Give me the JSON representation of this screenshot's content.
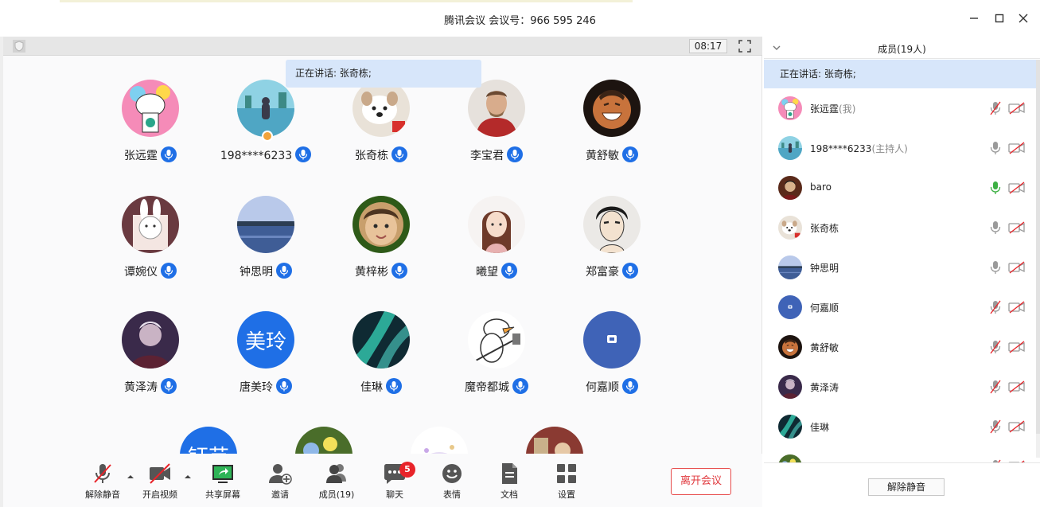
{
  "window": {
    "title": "腾讯会议 会议号：966 595 246"
  },
  "meeting": {
    "timer": "08:17",
    "speaking_tip": "正在讲话: 张奇栋;"
  },
  "tiles": [
    {
      "name": "张远霆",
      "avatar": "kid-drawing",
      "text": ""
    },
    {
      "name": "198****6233",
      "avatar": "lake-figure",
      "text": "",
      "host": true
    },
    {
      "name": "张奇栋",
      "avatar": "dog",
      "text": ""
    },
    {
      "name": "李宝君",
      "avatar": "man-red",
      "text": ""
    },
    {
      "name": "黄舒敏",
      "avatar": "laughing",
      "text": ""
    },
    {
      "name": "谭婉仪",
      "avatar": "bunny",
      "text": ""
    },
    {
      "name": "钟思明",
      "avatar": "lakeview",
      "text": ""
    },
    {
      "name": "黄梓彬",
      "avatar": "child",
      "text": ""
    },
    {
      "name": "曦望",
      "avatar": "girl",
      "text": ""
    },
    {
      "name": "郑富豪",
      "avatar": "anime-man",
      "text": ""
    },
    {
      "name": "黄泽涛",
      "avatar": "dark-figure",
      "text": ""
    },
    {
      "name": "唐美玲",
      "avatar": "text-blue",
      "text": "美玲"
    },
    {
      "name": "佳琳",
      "avatar": "aurora",
      "text": ""
    },
    {
      "name": "魔帝都城",
      "avatar": "duck",
      "text": ""
    },
    {
      "name": "何嘉顺",
      "avatar": "blue-icon",
      "text": ""
    },
    {
      "name": "",
      "avatar": "text-blue",
      "text": "钰芸"
    },
    {
      "name": "",
      "avatar": "flowers",
      "text": ""
    },
    {
      "name": "",
      "avatar": "cartoon",
      "text": ""
    },
    {
      "name": "",
      "avatar": "red-scene",
      "text": ""
    }
  ],
  "toolbar": {
    "unmute": "解除静音",
    "video": "开启视频",
    "share": "共享屏幕",
    "invite": "邀请",
    "members": "成员(19)",
    "chat": "聊天",
    "chat_badge": "5",
    "emoji": "表情",
    "docs": "文档",
    "settings": "设置",
    "leave": "离开会议"
  },
  "panel": {
    "title": "成员(19人)",
    "speaking": "正在讲话: 张奇栋;",
    "unmute_all": "解除静音",
    "members": [
      {
        "name": "张远霆",
        "role": "(我)",
        "avatar": "kid-drawing",
        "mic": "muted"
      },
      {
        "name": "198****6233",
        "role": "(主持人)",
        "avatar": "lake-figure",
        "mic": "on"
      },
      {
        "name": "baro",
        "role": "",
        "avatar": "baro",
        "mic": "speaking"
      },
      {
        "name": "张奇栋",
        "role": "",
        "avatar": "dog",
        "mic": "on"
      },
      {
        "name": "钟思明",
        "role": "",
        "avatar": "lakeview",
        "mic": "on"
      },
      {
        "name": "何嘉顺",
        "role": "",
        "avatar": "blue-icon",
        "mic": "muted"
      },
      {
        "name": "黄舒敏",
        "role": "",
        "avatar": "laughing",
        "mic": "muted"
      },
      {
        "name": "黄泽涛",
        "role": "",
        "avatar": "dark-figure",
        "mic": "muted"
      },
      {
        "name": "佳琳",
        "role": "",
        "avatar": "aurora",
        "mic": "muted"
      },
      {
        "name": "",
        "role": "",
        "avatar": "flowers",
        "mic": "muted"
      }
    ]
  },
  "colors": {
    "accent": "#1f6fe6",
    "speaking_bg": "#d7e6fa",
    "leave": "#e0393e",
    "badge": "#e8242a",
    "mic_active": "#3cb043"
  }
}
